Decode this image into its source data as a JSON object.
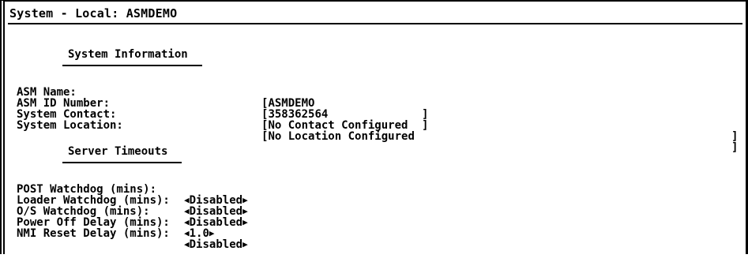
{
  "window": {
    "title": "System - Local: ASMDEMO"
  },
  "system_information": {
    "heading": "System Information",
    "fields": [
      {
        "label": "ASM Name:",
        "open": "[",
        "value": "ASMDEMO",
        "close": "]"
      },
      {
        "label": "ASM ID Number:",
        "open": "[",
        "value": "358362564",
        "close": "]"
      },
      {
        "label": "System Contact:",
        "open": "[",
        "value": "No Contact Configured",
        "close": "]"
      },
      {
        "label": "System Location:",
        "open": "[",
        "value": "No Location Configured",
        "close": "]"
      }
    ]
  },
  "server_timeouts": {
    "heading": "Server Timeouts",
    "fields": [
      {
        "label": "POST Watchdog (mins):",
        "value": "Disabled"
      },
      {
        "label": "Loader Watchdog (mins):",
        "value": "Disabled"
      },
      {
        "label": "O/S Watchdog (mins):",
        "value": "Disabled"
      },
      {
        "label": "Power Off Delay (mins):",
        "value": "1.0"
      },
      {
        "label": "NMI Reset Delay (mins):",
        "value": "Disabled"
      }
    ],
    "arrow_left": "◀",
    "arrow_right": "▶"
  }
}
